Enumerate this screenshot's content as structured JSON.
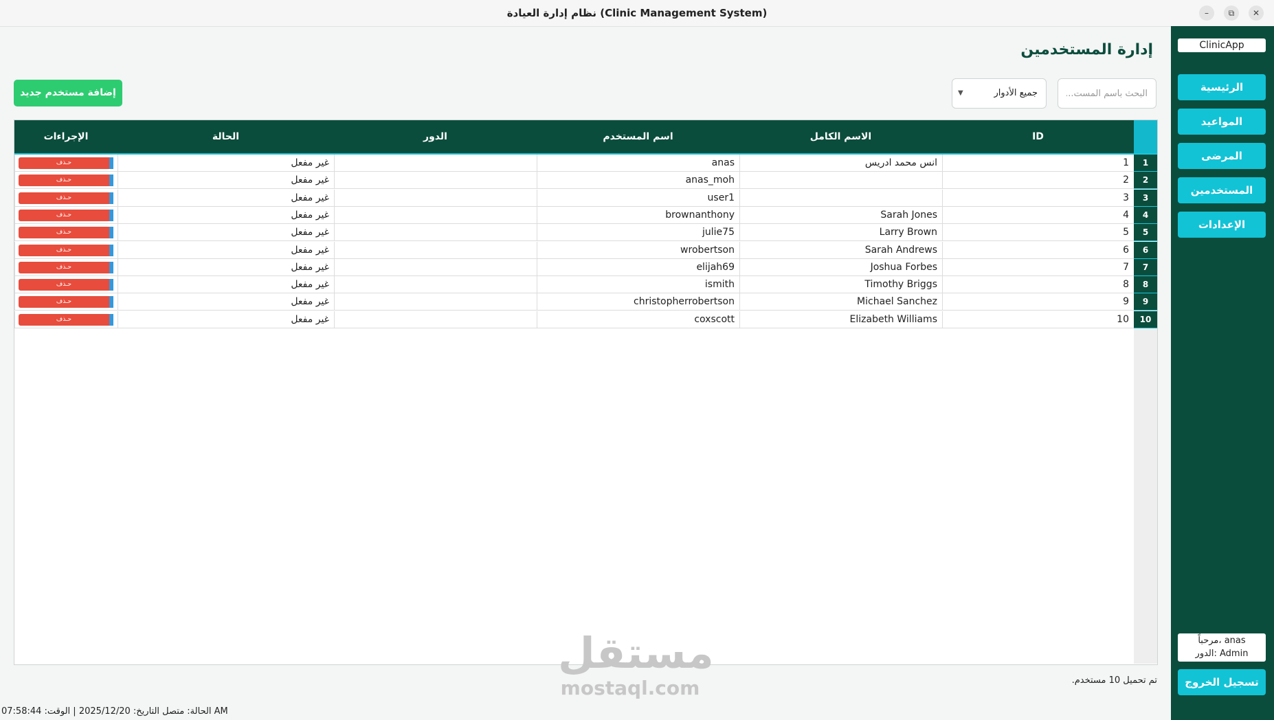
{
  "window": {
    "title": "نظام إدارة العيادة (Clinic Management System)",
    "minimize_label": "–",
    "maximize_label": "⧉",
    "close_label": "✕"
  },
  "sidebar": {
    "app_name": "ClinicApp",
    "items": [
      {
        "label": "الرئيسية"
      },
      {
        "label": "المواعيد"
      },
      {
        "label": "المرضى"
      },
      {
        "label": "المستخدمين"
      },
      {
        "label": "الإعدادات"
      }
    ],
    "welcome_text": "مرحباً، anas",
    "role_text": "الدور: Admin",
    "logout_label": "تسجيل الخروج"
  },
  "main": {
    "page_title": "إدارة المستخدمين",
    "search_placeholder": "البحث باسم المست...",
    "role_filter_value": "جميع الأدوار",
    "role_filter_caret": "▼",
    "add_user_label": "إضافة مستخدم جديد",
    "load_status": "تم تحميل 10 مستخدم."
  },
  "table": {
    "columns": [
      "ID",
      "الاسم الكامل",
      "اسم المستخدم",
      "الدور",
      "الحالة",
      "الإجراءات"
    ],
    "action_label": "حـذف",
    "rows": [
      {
        "row_no": "1",
        "id": "1",
        "full_name": "انس محمد ادريس",
        "username": "anas",
        "role": "",
        "status": "غير مفعل"
      },
      {
        "row_no": "2",
        "id": "2",
        "full_name": "",
        "username": "anas_moh",
        "role": "",
        "status": "غير مفعل"
      },
      {
        "row_no": "3",
        "id": "3",
        "full_name": "",
        "username": "user1",
        "role": "",
        "status": "غير مفعل"
      },
      {
        "row_no": "4",
        "id": "4",
        "full_name": "Sarah Jones",
        "username": "brownanthony",
        "role": "",
        "status": "غير مفعل"
      },
      {
        "row_no": "5",
        "id": "5",
        "full_name": "Larry Brown",
        "username": "julie75",
        "role": "",
        "status": "غير مفعل"
      },
      {
        "row_no": "6",
        "id": "6",
        "full_name": "Sarah Andrews",
        "username": "wrobertson",
        "role": "",
        "status": "غير مفعل"
      },
      {
        "row_no": "7",
        "id": "7",
        "full_name": "Joshua Forbes",
        "username": "elijah69",
        "role": "",
        "status": "غير مفعل"
      },
      {
        "row_no": "8",
        "id": "8",
        "full_name": "Timothy Briggs",
        "username": "ismith",
        "role": "",
        "status": "غير مفعل"
      },
      {
        "row_no": "9",
        "id": "9",
        "full_name": "Michael Sanchez",
        "username": "christopherrobertson",
        "role": "",
        "status": "غير مفعل"
      },
      {
        "row_no": "10",
        "id": "10",
        "full_name": "Elizabeth Williams",
        "username": "coxscott",
        "role": "",
        "status": "غير مفعل"
      }
    ]
  },
  "statusbar": {
    "text": "الحالة: متصل  التاريخ: 2025/12/20  |  الوقت: 07:58:44 AM"
  },
  "watermark": {
    "arabic": "مستقل",
    "latin": "mostaql.com"
  }
}
